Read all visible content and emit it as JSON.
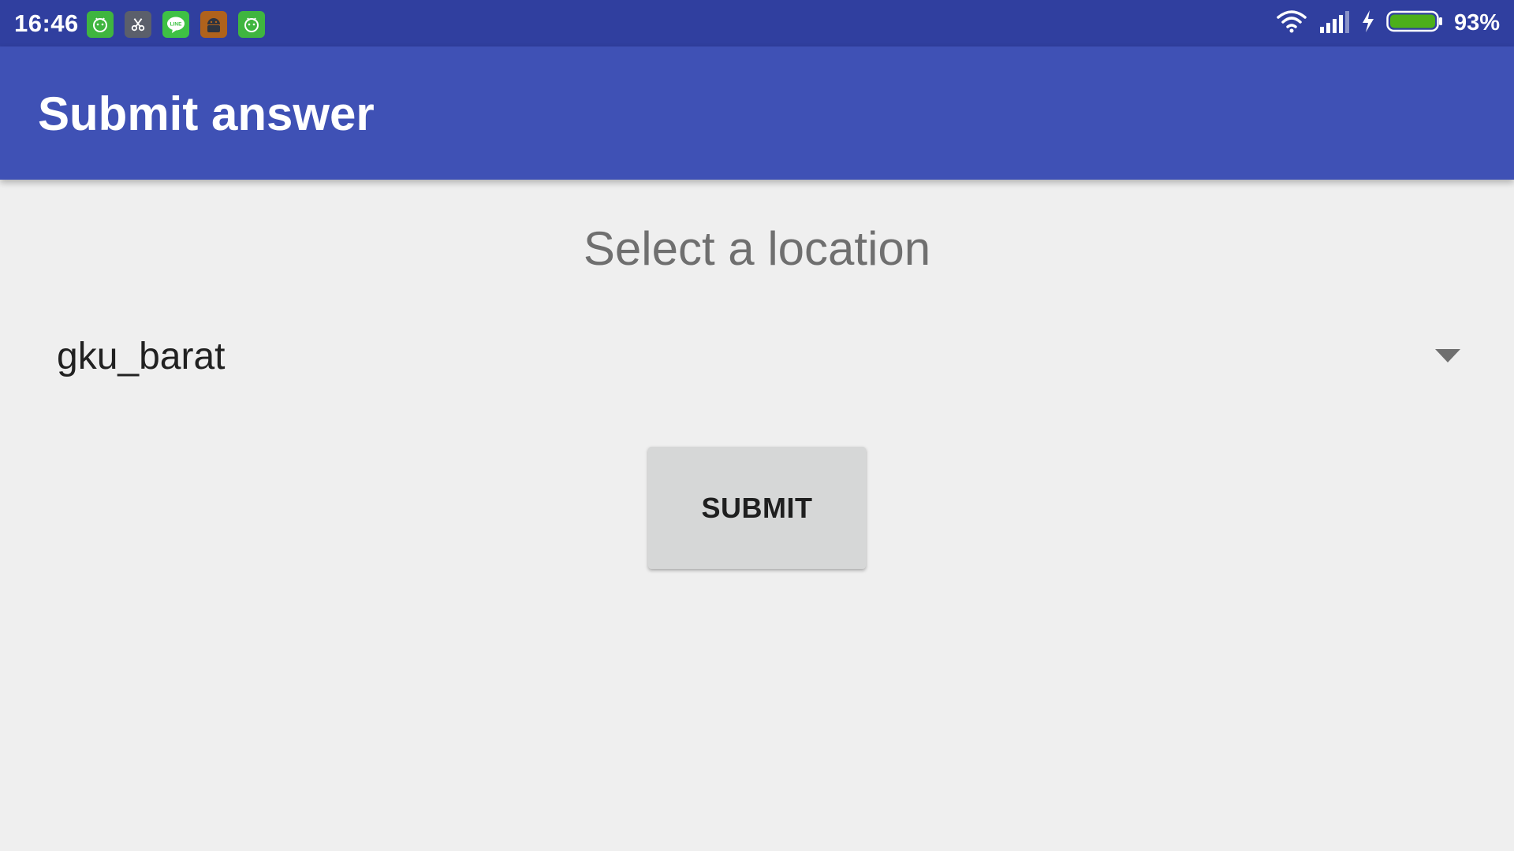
{
  "status_bar": {
    "time": "16:46",
    "notification_icons": [
      "android-icon",
      "scissors-icon",
      "line-icon",
      "android-robot-icon",
      "android-icon"
    ],
    "battery_percent": "93%",
    "colors": {
      "background": "#303f9f",
      "battery_fill": "#4caf1a"
    }
  },
  "app_bar": {
    "title": "Submit answer",
    "color": "#3f51b5"
  },
  "main": {
    "prompt": "Select a location",
    "location_spinner": {
      "selected_value": "gku_barat"
    },
    "submit_label": "SUBMIT"
  }
}
